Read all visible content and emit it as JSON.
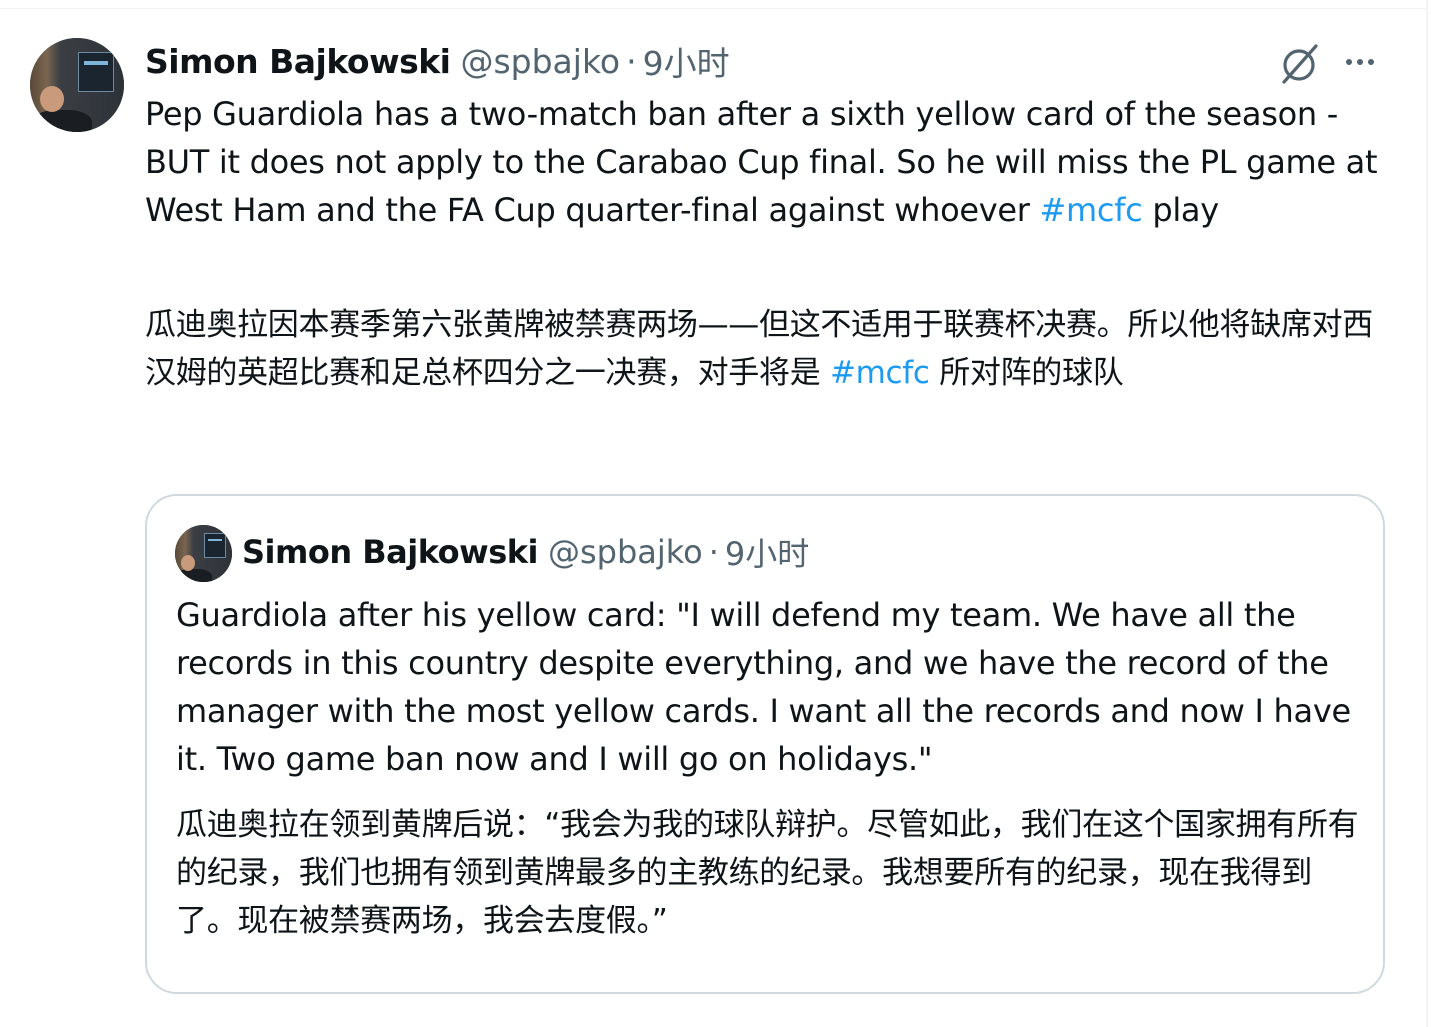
{
  "tweet": {
    "author_name": "Simon Bajkowski",
    "author_handle": "@spbajko",
    "separator": "·",
    "time": "9小时",
    "text_en_before": "Pep Guardiola has a two-match ban after a sixth yellow card of the season - BUT it does not apply to the Carabao Cup final. So he will miss the PL game at West Ham and the FA Cup quarter-final against whoever ",
    "text_en_hashtag": "#mcfc",
    "text_en_after": " play",
    "text_zh_before": "瓜迪奥拉因本赛季第六张黄牌被禁赛两场——但这不适用于联赛杯决赛。所以他将缺席对西汉姆的英超比赛和足总杯四分之一决赛，对手将是 ",
    "text_zh_hashtag": "#mcfc",
    "text_zh_after": " 所对阵的球队",
    "grok_icon": "grok-icon",
    "more_icon": "more-icon"
  },
  "quoted": {
    "author_name": "Simon Bajkowski",
    "author_handle": "@spbajko",
    "separator": "·",
    "time": "9小时",
    "text_en": "Guardiola after his yellow card: \"I will defend my team. We have all the records in this country despite everything, and we have the record of the manager with the most yellow cards. I want all the records and now I have it. Two game ban now and I will go on holidays.\"",
    "text_zh": "瓜迪奥拉在领到黄牌后说：“我会为我的球队辩护。尽管如此，我们在这个国家拥有所有的纪录，我们也拥有领到黄牌最多的主教练的纪录。我想要所有的纪录，现在我得到了。现在被禁赛两场，我会去度假。”"
  },
  "colors": {
    "text": "#0f1419",
    "secondary": "#536471",
    "link": "#1d9bf0",
    "border": "#cfd9de"
  }
}
